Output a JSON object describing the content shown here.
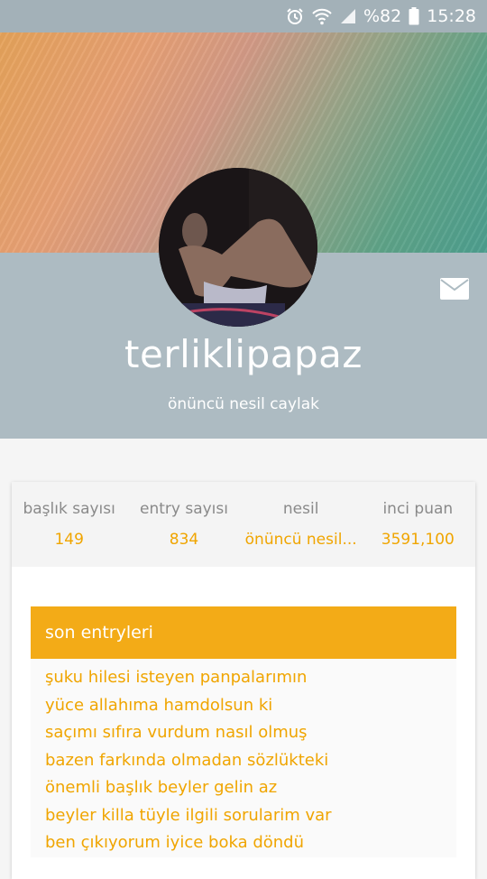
{
  "status_bar": {
    "battery_percent": "%82",
    "time": "15:28",
    "icons": [
      "alarm-icon",
      "wifi-icon",
      "signal-icon",
      "battery-icon"
    ]
  },
  "profile": {
    "username": "terliklipapaz",
    "generation": "önüncü nesil caylak",
    "icons": [
      "avatar",
      "mail-icon"
    ]
  },
  "stats": [
    {
      "label": "başlık sayısı",
      "value": "149"
    },
    {
      "label": "entry sayısı",
      "value": "834"
    },
    {
      "label": "nesil",
      "value": "önüncü nesil..."
    },
    {
      "label": "inci puan",
      "value": "3591,100"
    }
  ],
  "recent": {
    "title": "son entryleri",
    "entries": [
      "şuku hilesi isteyen panpalarımın",
      "yüce allahıma hamdolsun ki",
      "saçımı sıfıra vurdum nasıl olmuş",
      "bazen farkında olmadan sözlükteki",
      "önemli başlık beyler gelin az",
      "beyler killa tüyle ilgili sorularim var",
      "ben çıkıyorum iyice boka döndü"
    ]
  },
  "colors": {
    "accent": "#f3ab17",
    "link": "#f0a500",
    "band": "#adbbc2",
    "status_bar": "#a3b1b8"
  }
}
